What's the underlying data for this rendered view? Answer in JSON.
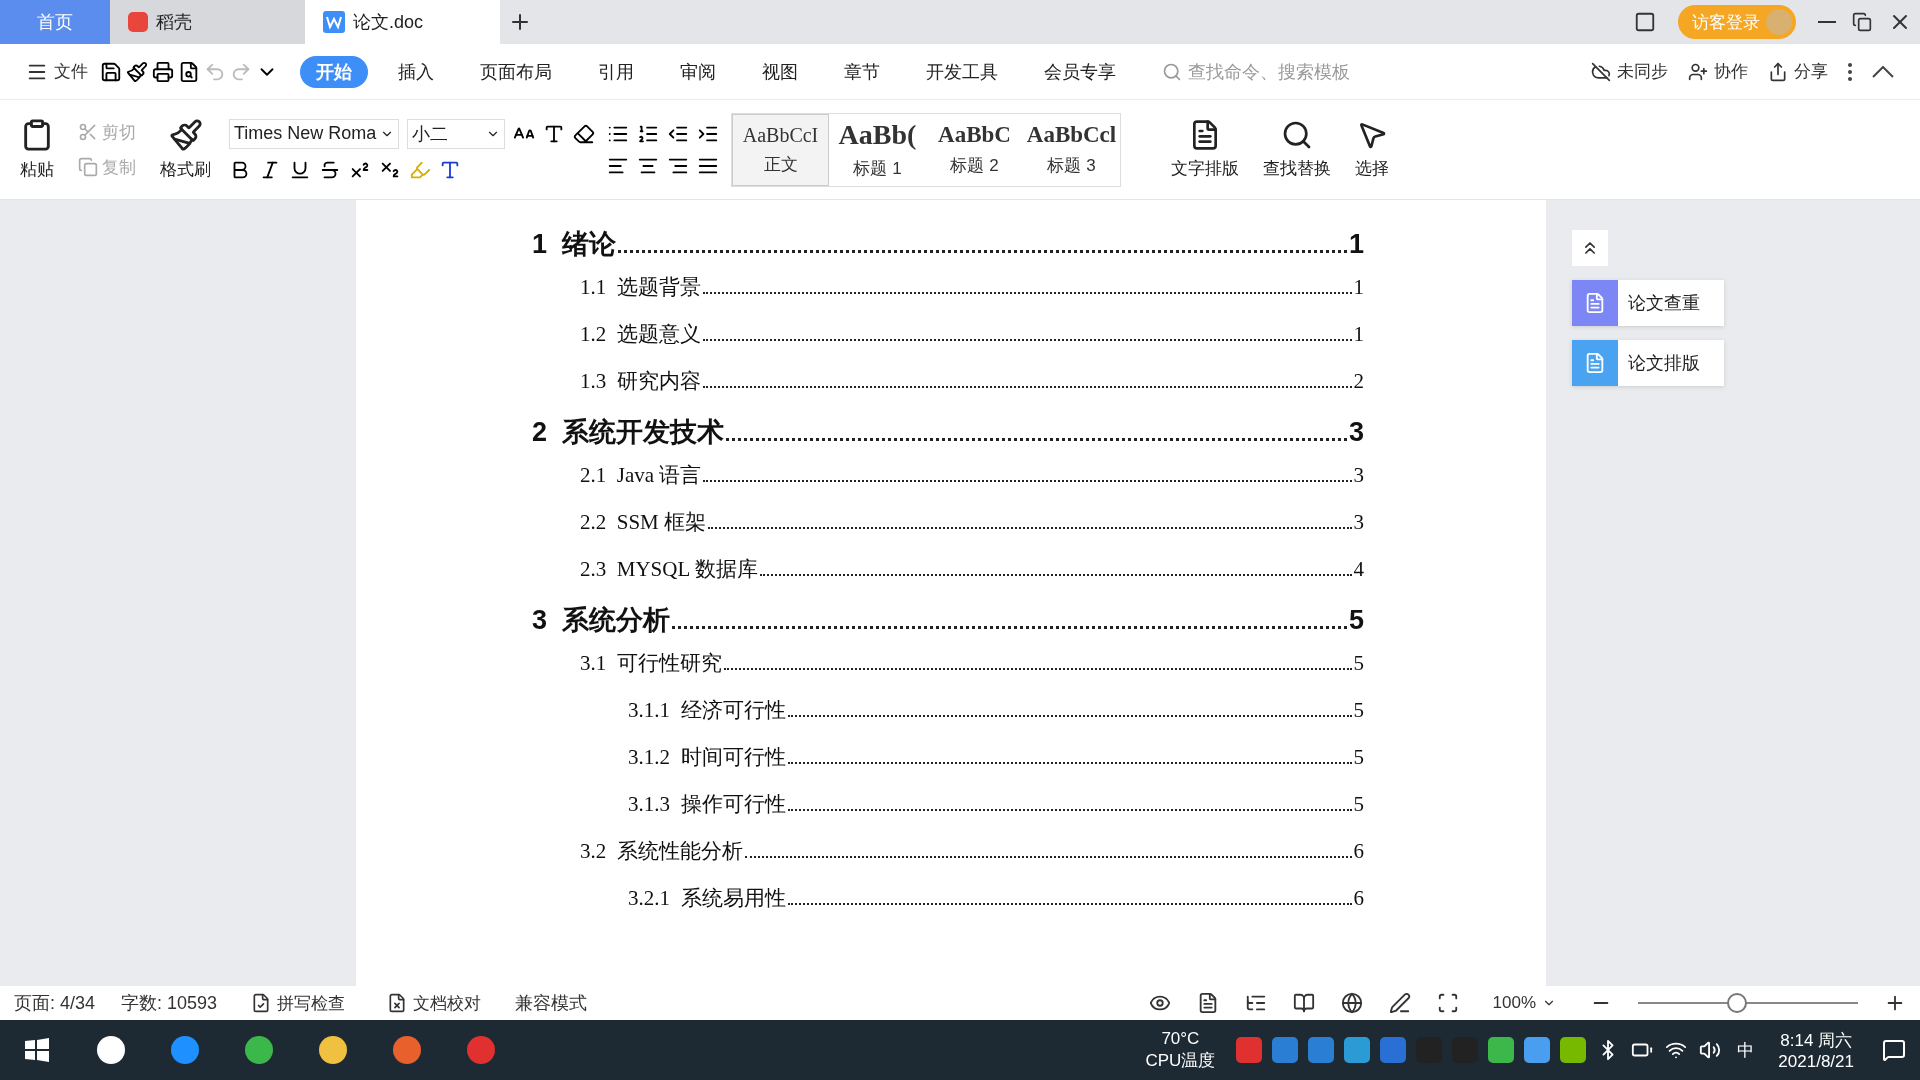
{
  "tabs": [
    {
      "label": "首页",
      "kind": "home",
      "selected": false
    },
    {
      "label": "稻壳",
      "kind": "docer",
      "selected": false
    },
    {
      "label": "论文.doc",
      "kind": "doc",
      "selected": true
    }
  ],
  "title_bar": {
    "login_button": "访客登录"
  },
  "menu": {
    "file": "文件",
    "tabs": [
      {
        "label": "开始",
        "selected": true
      },
      {
        "label": "插入",
        "selected": false
      },
      {
        "label": "页面布局",
        "selected": false
      },
      {
        "label": "引用",
        "selected": false
      },
      {
        "label": "审阅",
        "selected": false
      },
      {
        "label": "视图",
        "selected": false
      },
      {
        "label": "章节",
        "selected": false
      },
      {
        "label": "开发工具",
        "selected": false
      },
      {
        "label": "会员专享",
        "selected": false
      }
    ],
    "search_placeholder": "查找命令、搜索模板",
    "actions": [
      "未同步",
      "协作",
      "分享"
    ]
  },
  "ribbon": {
    "clipboard": [
      {
        "label": "剪切",
        "disabled": true
      },
      {
        "label": "复制",
        "disabled": true
      }
    ],
    "paste": "粘贴",
    "format_painter": "格式刷",
    "font_name": "Times New Roma",
    "font_size": "小二",
    "styles": [
      {
        "sample": "AaBbCcI",
        "label": "正文",
        "kind": "normal",
        "selected": true
      },
      {
        "sample": "AaBb(",
        "label": "标题 1",
        "kind": "h1",
        "selected": false
      },
      {
        "sample": "AaBbC",
        "label": "标题 2",
        "kind": "h2",
        "selected": false
      },
      {
        "sample": "AaBbCcl",
        "label": "标题 3",
        "kind": "h3",
        "selected": false
      }
    ],
    "tools": [
      "文字排版",
      "查找替换",
      "选择"
    ]
  },
  "toc": [
    {
      "number": "1",
      "title": "绪论",
      "page": "1",
      "children": [
        {
          "number": "1.1",
          "title": "选题背景",
          "page": "1"
        },
        {
          "number": "1.2",
          "title": "选题意义",
          "page": "1"
        },
        {
          "number": "1.3",
          "title": "研究内容",
          "page": "2"
        }
      ]
    },
    {
      "number": "2",
      "title": "系统开发技术",
      "page": "3",
      "children": [
        {
          "number": "2.1",
          "title": "Java 语言",
          "page": "3"
        },
        {
          "number": "2.2",
          "title": "SSM 框架",
          "page": "3"
        },
        {
          "number": "2.3",
          "title": "MYSQL 数据库",
          "page": "4"
        }
      ]
    },
    {
      "number": "3",
      "title": "系统分析",
      "page": "5",
      "children": [
        {
          "number": "3.1",
          "title": "可行性研究",
          "page": "5",
          "children": [
            {
              "number": "3.1.1",
              "title": "经济可行性",
              "page": "5"
            },
            {
              "number": "3.1.2",
              "title": "时间可行性",
              "page": "5"
            },
            {
              "number": "3.1.3",
              "title": "操作可行性",
              "page": "5"
            }
          ]
        },
        {
          "number": "3.2",
          "title": "系统性能分析",
          "page": "6",
          "children": [
            {
              "number": "3.2.1",
              "title": "系统易用性",
              "page": "6"
            }
          ]
        }
      ]
    }
  ],
  "side_panel": [
    "论文查重",
    "论文排版"
  ],
  "status_bar": {
    "page": "页面: 4/34",
    "words": "字数: 10593",
    "spell": "拼写检查",
    "proof": "文档校对",
    "mode": "兼容模式",
    "zoom": "100%",
    "zoom_slider": {
      "level": 0.45
    }
  },
  "taskbar": {
    "temp": "70°C",
    "temp_label": "CPU温度",
    "ime": "中",
    "time": "8:14 周六",
    "date": "2021/8/21"
  }
}
